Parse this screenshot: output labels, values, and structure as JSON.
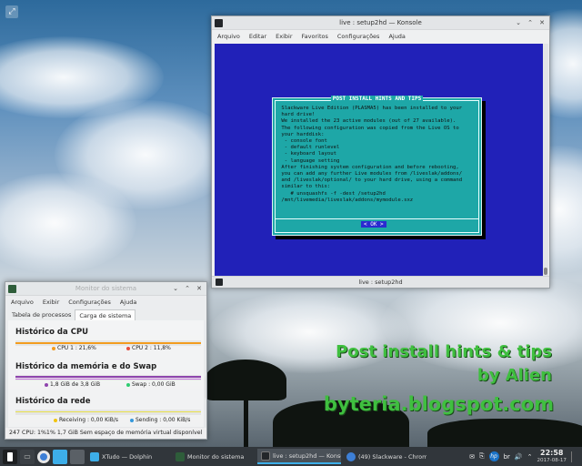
{
  "konsole": {
    "title": "live : setup2hd — Konsole",
    "menu": [
      "Arquivo",
      "Editar",
      "Exibir",
      "Favoritos",
      "Configurações",
      "Ajuda"
    ],
    "tab_label": "live : setup2hd",
    "dialog": {
      "title": "POST INSTALL HINTS AND TIPS",
      "body": " Slackware Live Edition (PLASMA5) has been installed to your\n hard drive!\n We installed the 23 active modules (out of 27 available).\n The following configuration was copied from the Live OS to\n your harddisk:\n  - console font\n  - default runlevel\n  - keyboard layout\n  - language setting\n After finishing system configuration and before rebooting,\n you can add any further Live modules from /liveslak/addons/\n and /liveslak/optional/ to your hard drive, using a command\n similar to this:\n    # unsquashfs -f -dest /setup2hd\n /mnt/livemedia/liveslak/addons/mymodule.sxz",
      "ok": "< OK >"
    }
  },
  "sysmon": {
    "title": "Monitor do sistema",
    "menu": [
      "Arquivo",
      "Exibir",
      "Configurações",
      "Ajuda"
    ],
    "tabs": [
      "Tabela de processos",
      "Carga de sistema"
    ],
    "cpu": {
      "heading": "Histórico da CPU",
      "cpu1": "CPU 1 : 21,6%",
      "cpu2": "CPU 2 : 11,8%"
    },
    "mem": {
      "heading": "Histórico da memória e do Swap",
      "memory": "1,8 GiB de 3,8 GiB",
      "swap": "Swap : 0,00 GiB"
    },
    "net": {
      "heading": "Histórico da rede",
      "receiving": "Receiving : 0,00 KiB/s",
      "sending": "Sending : 0,00 KiB/s"
    },
    "status": "247  CPU: 1%1%  1,7 GiB  Sem espaço de memória virtual disponível"
  },
  "overlay": {
    "line1": "Post install hints & tips",
    "line2": "by Alien",
    "line3": "byteria.blogspot.com"
  },
  "taskbar": {
    "tasks": [
      "XTudo — Dolphin",
      "Monitor do sistema",
      "live : setup2hd — Konsole",
      "(49) Slackware - Chromi..."
    ],
    "lang": "br",
    "time": "22:58",
    "date": "2017-08-17"
  },
  "colors": {
    "terminal_bg": "#2121b8",
    "dialog_bg": "#1ea7a7",
    "overlay_text": "#3fbf3f",
    "cpu1": "#f39c1f",
    "cpu2": "#e74c3c",
    "memory": "#8e44ad",
    "swap": "#2ecc71",
    "taskbar_bg": "#31363b",
    "active_task": "#3daee9"
  }
}
